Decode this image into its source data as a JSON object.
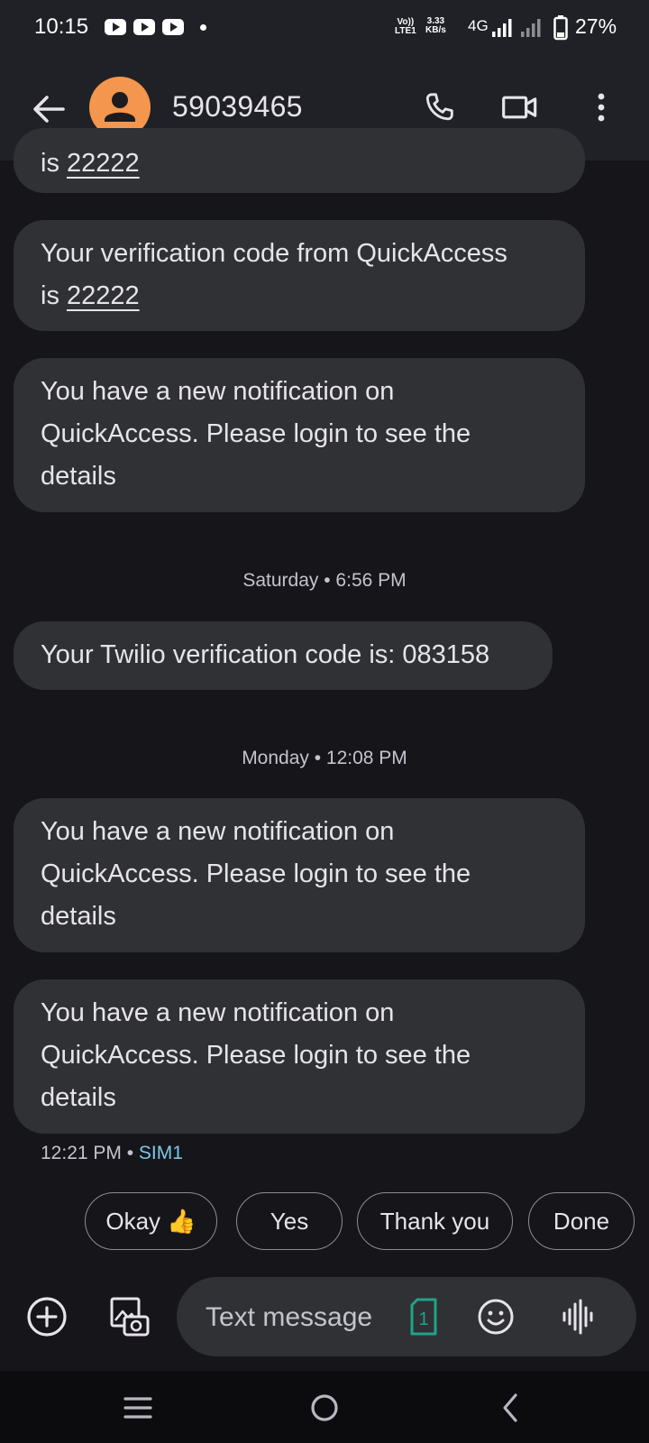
{
  "status_bar": {
    "time": "10:15",
    "network_top": "Vo))",
    "network_bottom": "LTE1",
    "speed_value": "3.33",
    "speed_unit": "KB/s",
    "network_type": "4G",
    "battery": "27%"
  },
  "header": {
    "contact_name": "59039465"
  },
  "messages": {
    "partial": {
      "prefix": "is ",
      "code": "22222"
    },
    "m1": {
      "text": "Your verification code from QuickAccess",
      "prefix": "is ",
      "code": "22222"
    },
    "m2": {
      "line1": "You have a new notification on",
      "line2": "QuickAccess. Please login to see the",
      "line3": "details"
    },
    "sep1": "Saturday • 6:56 PM",
    "m3": {
      "text": "Your Twilio verification code is: 083158"
    },
    "sep2": "Monday • 12:08 PM",
    "m4": {
      "line1": "You have a new notification on",
      "line2": "QuickAccess. Please login to see the",
      "line3": "details"
    },
    "m5": {
      "line1": "You have a new notification on",
      "line2": "QuickAccess. Please login to see the",
      "line3": "details"
    },
    "last_time": "12:21 PM",
    "last_sim": "SIM1"
  },
  "suggestions": [
    "Okay 👍",
    "Yes",
    "Thank you",
    "Done"
  ],
  "compose": {
    "placeholder": "Text message",
    "sim_number": "1"
  },
  "colors": {
    "accent_avatar": "#f4964d",
    "sim_teal": "#1fa38a",
    "sim_label": "#7fc7e6"
  }
}
